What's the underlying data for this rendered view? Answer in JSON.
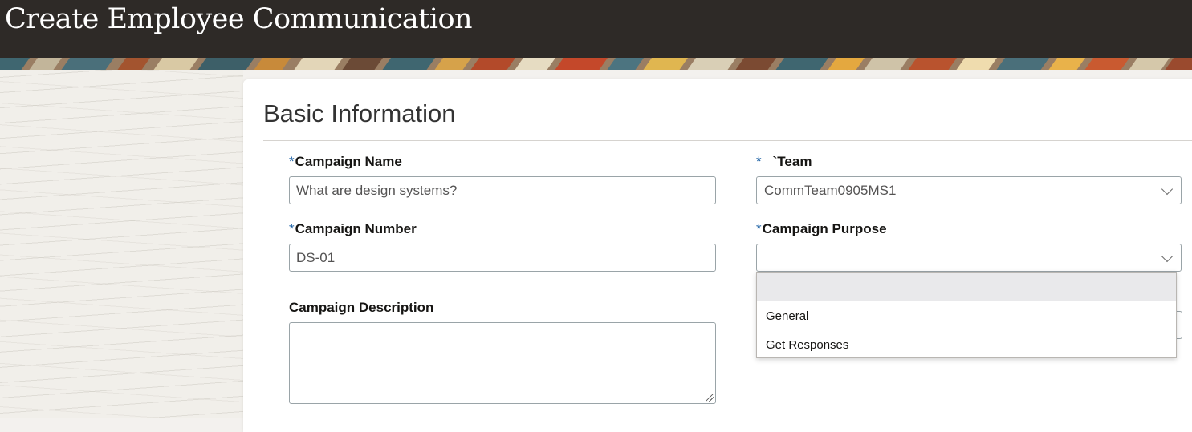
{
  "header": {
    "title": "Create Employee Communication"
  },
  "section": {
    "title": "Basic Information"
  },
  "form": {
    "required_mark": "*",
    "campaign_name": {
      "label": "Campaign Name",
      "value": "What are design systems?"
    },
    "team": {
      "label": "`Team",
      "value": "CommTeam0905MS1",
      "icon": "chevron-down-icon"
    },
    "campaign_number": {
      "label": "Campaign Number",
      "value": "DS-01"
    },
    "campaign_purpose": {
      "label": "Campaign Purpose",
      "value": "",
      "icon": "chevron-down-icon",
      "options": [
        "",
        "General",
        "Get Responses"
      ],
      "highlighted_index": 0
    },
    "campaign_description": {
      "label": "Campaign Description",
      "value": ""
    }
  },
  "colors": {
    "header_bg": "#2e2a27",
    "required_asterisk": "#1a5fa3",
    "field_border": "#9aa4a8",
    "option_highlight": "#e9e9eb"
  }
}
